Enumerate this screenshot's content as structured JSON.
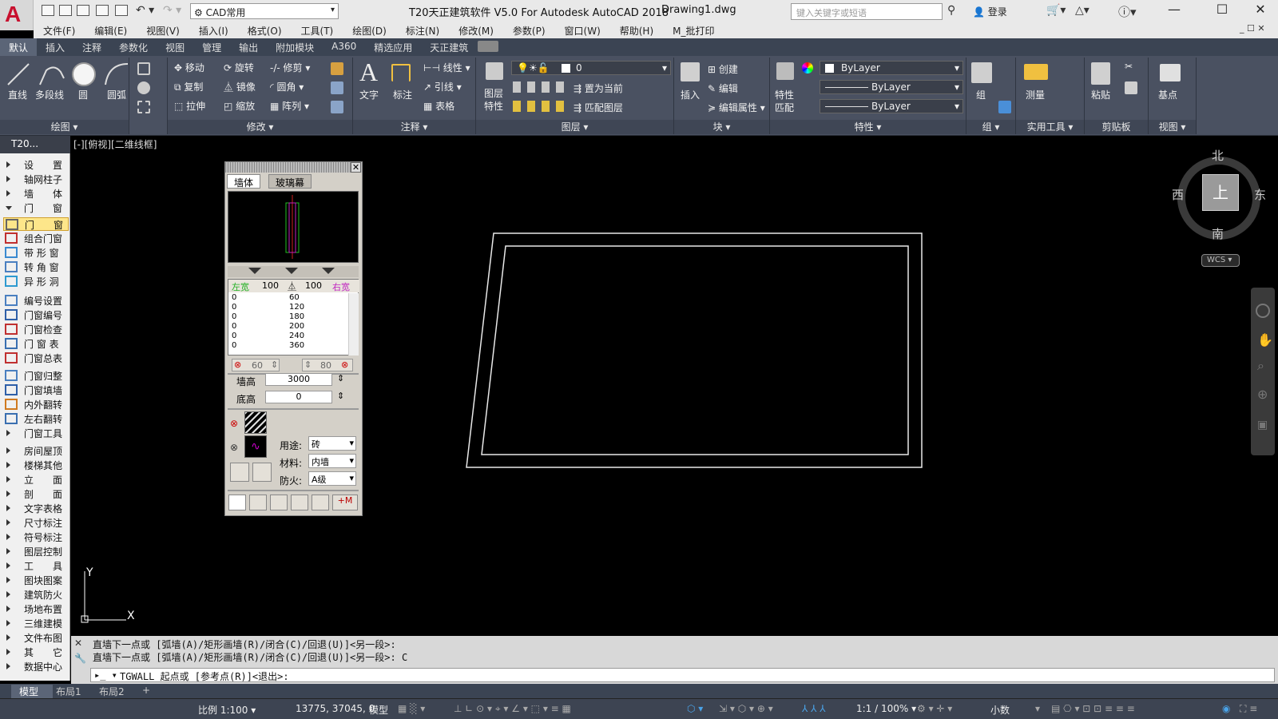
{
  "title_bar": {
    "logo": "A",
    "workspace": "CAD常用",
    "app_title": "T20天正建筑软件 V5.0 For Autodesk AutoCAD 2018",
    "drawing": "Drawing1.dwg",
    "search_placeholder": "键入关键字或短语",
    "login": "登录"
  },
  "menu": [
    "文件(F)",
    "编辑(E)",
    "视图(V)",
    "插入(I)",
    "格式(O)",
    "工具(T)",
    "绘图(D)",
    "标注(N)",
    "修改(M)",
    "参数(P)",
    "窗口(W)",
    "帮助(H)",
    "M_批打印"
  ],
  "ribbon_tabs": [
    "默认",
    "插入",
    "注释",
    "参数化",
    "视图",
    "管理",
    "输出",
    "附加模块",
    "A360",
    "精选应用",
    "天正建筑"
  ],
  "ribbon": {
    "draw": {
      "line": "直线",
      "pline": "多段线",
      "circle": "圆",
      "arc": "圆弧",
      "title": "绘图 ▾"
    },
    "modify": {
      "move": "移动",
      "rotate": "旋转",
      "trim": "修剪",
      "copy": "复制",
      "mirror": "镜像",
      "fillet": "圆角",
      "stretch": "拉伸",
      "scale": "缩放",
      "array": "阵列",
      "title": "修改 ▾"
    },
    "annotation": {
      "text": "文字",
      "dim": "标注",
      "linear": "线性",
      "leader": "引线",
      "table": "表格",
      "title": "注释 ▾"
    },
    "layers": {
      "props_top": "图层",
      "props_bottom": "特性",
      "layer_value": "0",
      "set_current": "置为当前",
      "match_layer": "匹配图层",
      "title": "图层 ▾"
    },
    "block": {
      "insert": "插入",
      "create": "创建",
      "edit": "编辑",
      "edit_attr": "编辑属性",
      "title": "块 ▾"
    },
    "properties": {
      "match_top": "特性",
      "match_bottom": "匹配",
      "color": "ByLayer",
      "linetype": "ByLayer",
      "lineweight": "ByLayer",
      "title": "特性 ▾"
    },
    "groups": {
      "group": "组",
      "title": "组 ▾"
    },
    "utilities": {
      "measure": "测量",
      "title": "实用工具 ▾"
    },
    "clipboard": {
      "paste": "粘贴",
      "title": "剪贴板"
    },
    "view": {
      "base": "基点",
      "title": "视图 ▾"
    }
  },
  "left_panel": {
    "tab": "T20...",
    "items": [
      {
        "label": "设　　置",
        "kind": "tri"
      },
      {
        "label": "轴网柱子",
        "kind": "tri"
      },
      {
        "label": "墙　　体",
        "kind": "tri"
      },
      {
        "label": "门　　窗",
        "kind": "down"
      },
      {
        "label": "门　　窗",
        "kind": "icon",
        "selected": true
      },
      {
        "label": "组合门窗",
        "kind": "icon"
      },
      {
        "label": "带 形 窗",
        "kind": "icon"
      },
      {
        "label": "转 角 窗",
        "kind": "icon"
      },
      {
        "label": "异 形 洞",
        "kind": "icon"
      },
      {
        "label": "编号设置",
        "kind": "icon"
      },
      {
        "label": "门窗编号",
        "kind": "icon"
      },
      {
        "label": "门窗检查",
        "kind": "icon"
      },
      {
        "label": "门 窗 表",
        "kind": "icon"
      },
      {
        "label": "门窗总表",
        "kind": "icon"
      },
      {
        "label": "门窗归整",
        "kind": "icon"
      },
      {
        "label": "门窗填墙",
        "kind": "icon"
      },
      {
        "label": "内外翻转",
        "kind": "icon"
      },
      {
        "label": "左右翻转",
        "kind": "icon"
      },
      {
        "label": "门窗工具",
        "kind": "tri"
      },
      {
        "label": "房间屋顶",
        "kind": "tri"
      },
      {
        "label": "楼梯其他",
        "kind": "tri"
      },
      {
        "label": "立　　面",
        "kind": "tri"
      },
      {
        "label": "剖　　面",
        "kind": "tri"
      },
      {
        "label": "文字表格",
        "kind": "tri"
      },
      {
        "label": "尺寸标注",
        "kind": "tri"
      },
      {
        "label": "符号标注",
        "kind": "tri"
      },
      {
        "label": "图层控制",
        "kind": "tri"
      },
      {
        "label": "工　　具",
        "kind": "tri"
      },
      {
        "label": "图块图案",
        "kind": "tri"
      },
      {
        "label": "建筑防火",
        "kind": "tri"
      },
      {
        "label": "场地布置",
        "kind": "tri"
      },
      {
        "label": "三维建模",
        "kind": "tri"
      },
      {
        "label": "文件布图",
        "kind": "tri"
      },
      {
        "label": "其　　它",
        "kind": "tri"
      },
      {
        "label": "数据中心",
        "kind": "tri"
      }
    ]
  },
  "viewport_label": "[-][俯视][二维线框]",
  "dialog": {
    "tabs": [
      "墙体",
      "玻璃幕"
    ],
    "left_width_label": "左宽",
    "right_width_label": "右宽",
    "left_width": "100",
    "right_width": "100",
    "rows": [
      {
        "left": "0",
        "right": "60"
      },
      {
        "left": "0",
        "right": "120"
      },
      {
        "left": "0",
        "right": "180"
      },
      {
        "left": "0",
        "right": "200"
      },
      {
        "left": "0",
        "right": "240"
      },
      {
        "left": "0",
        "right": "360"
      }
    ],
    "spin_left": "60",
    "spin_right": "80",
    "wall_height_label": "墙高",
    "wall_height": "3000",
    "base_height_label": "底高",
    "base_height": "0",
    "usage_label": "用途:",
    "usage": "砖",
    "material_label": "材料:",
    "material": "内墙",
    "fire_label": "防火:",
    "fire": "A级"
  },
  "compass": {
    "north": "北",
    "south": "南",
    "east": "东",
    "west": "西",
    "top": "上",
    "wcs": "WCS"
  },
  "command_line": {
    "history": [
      "直墙下一点或 [弧墙(A)/矩形画墙(R)/闭合(C)/回退(U)]<另一段>:",
      "直墙下一点或 [弧墙(A)/矩形画墙(R)/闭合(C)/回退(U)]<另一段>: C"
    ],
    "current": "TGWALL 起点或 [参考点(R)]<退出>:"
  },
  "layout_tabs": [
    "模型",
    "布局1",
    "布局2",
    "+"
  ],
  "status_bar": {
    "scale": "比例 1:100 ▾",
    "coords": "13775, 37045, 0",
    "model": "模型",
    "annoscale": "1:1 / 100% ▾",
    "units": "小数"
  },
  "colors": {
    "accent": "#c8102e",
    "ribbon": "#4a5161",
    "canvas": "#000000"
  }
}
